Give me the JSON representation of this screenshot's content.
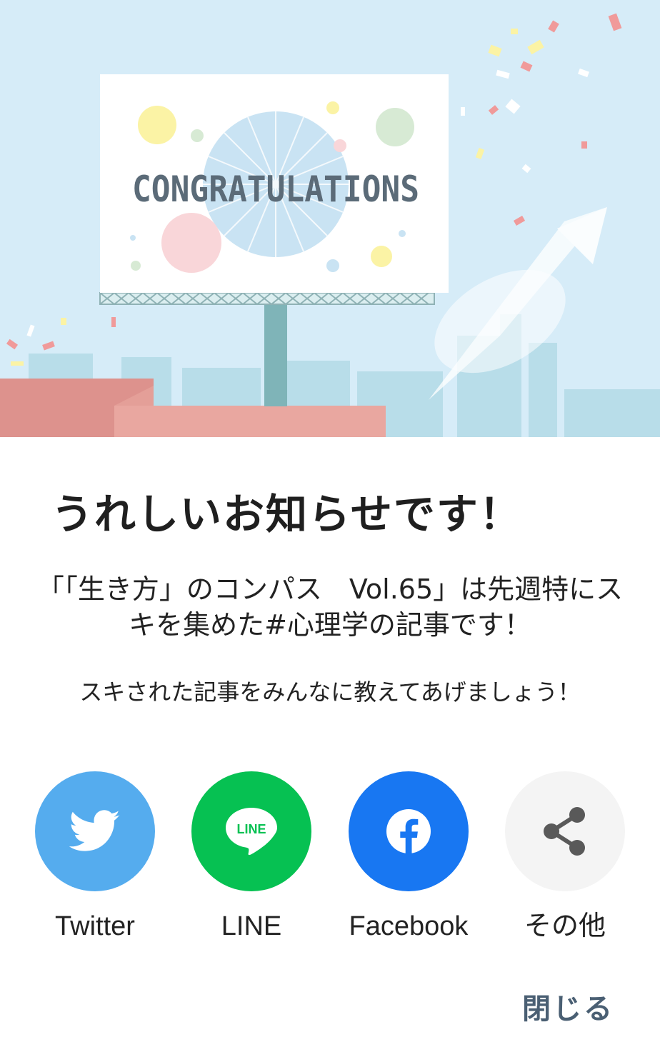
{
  "billboard": {
    "text": "CONGRATULATIONS"
  },
  "dialog": {
    "title": "うれしいお知らせです！",
    "message": "「「生き方」のコンパス　Vol.65」は先週特にスキを集めた#心理学の記事です！",
    "prompt": "スキされた記事をみんなに教えてあげましょう！"
  },
  "share": {
    "twitter": {
      "label": "Twitter",
      "color": "#55acee",
      "icon": "twitter-bird-icon"
    },
    "line": {
      "label": "LINE",
      "color": "#06c152",
      "icon": "line-logo-icon",
      "logo_text": "LINE"
    },
    "facebook": {
      "label": "Facebook",
      "color": "#1877f2",
      "icon": "facebook-f-icon"
    },
    "other": {
      "label": "その他",
      "color": "#f4f4f4",
      "icon": "share-icon"
    }
  },
  "close_label": "閉じる"
}
